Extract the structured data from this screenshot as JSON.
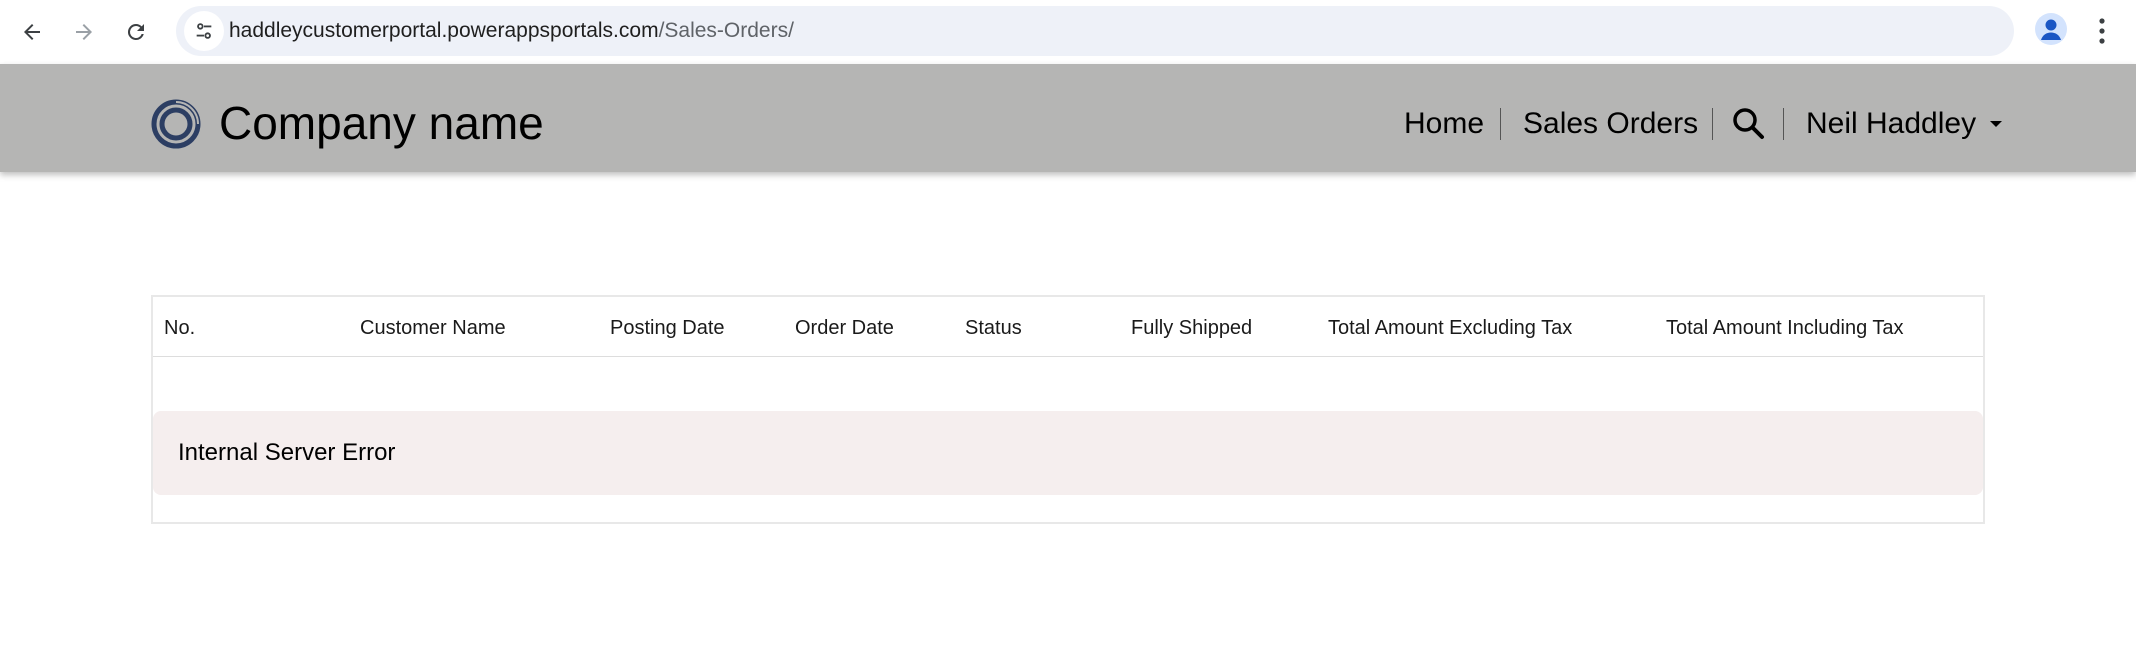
{
  "browser": {
    "url_host": "haddleycustomerportal.powerappsportals.com",
    "url_path": "/Sales-Orders/",
    "icons": {
      "back": "arrow-left-icon",
      "forward": "arrow-right-icon",
      "reload": "reload-icon",
      "site_info": "tune-icon",
      "bookmark": "star-icon",
      "profile": "person-icon",
      "menu": "three-dots-icon"
    }
  },
  "header": {
    "company_name": "Company name",
    "nav": {
      "home": "Home",
      "sales_orders": "Sales Orders"
    },
    "user_name": "Neil Haddley",
    "background_color": "#b5b5b4",
    "logo_color": "#2c3e63"
  },
  "table": {
    "columns": [
      "No.",
      "Customer Name",
      "Posting Date",
      "Order Date",
      "Status",
      "Fully Shipped",
      "Total Amount Excluding Tax",
      "Total Amount Including Tax"
    ],
    "error_message": "Internal Server Error",
    "error_background": "#f5eeee"
  }
}
